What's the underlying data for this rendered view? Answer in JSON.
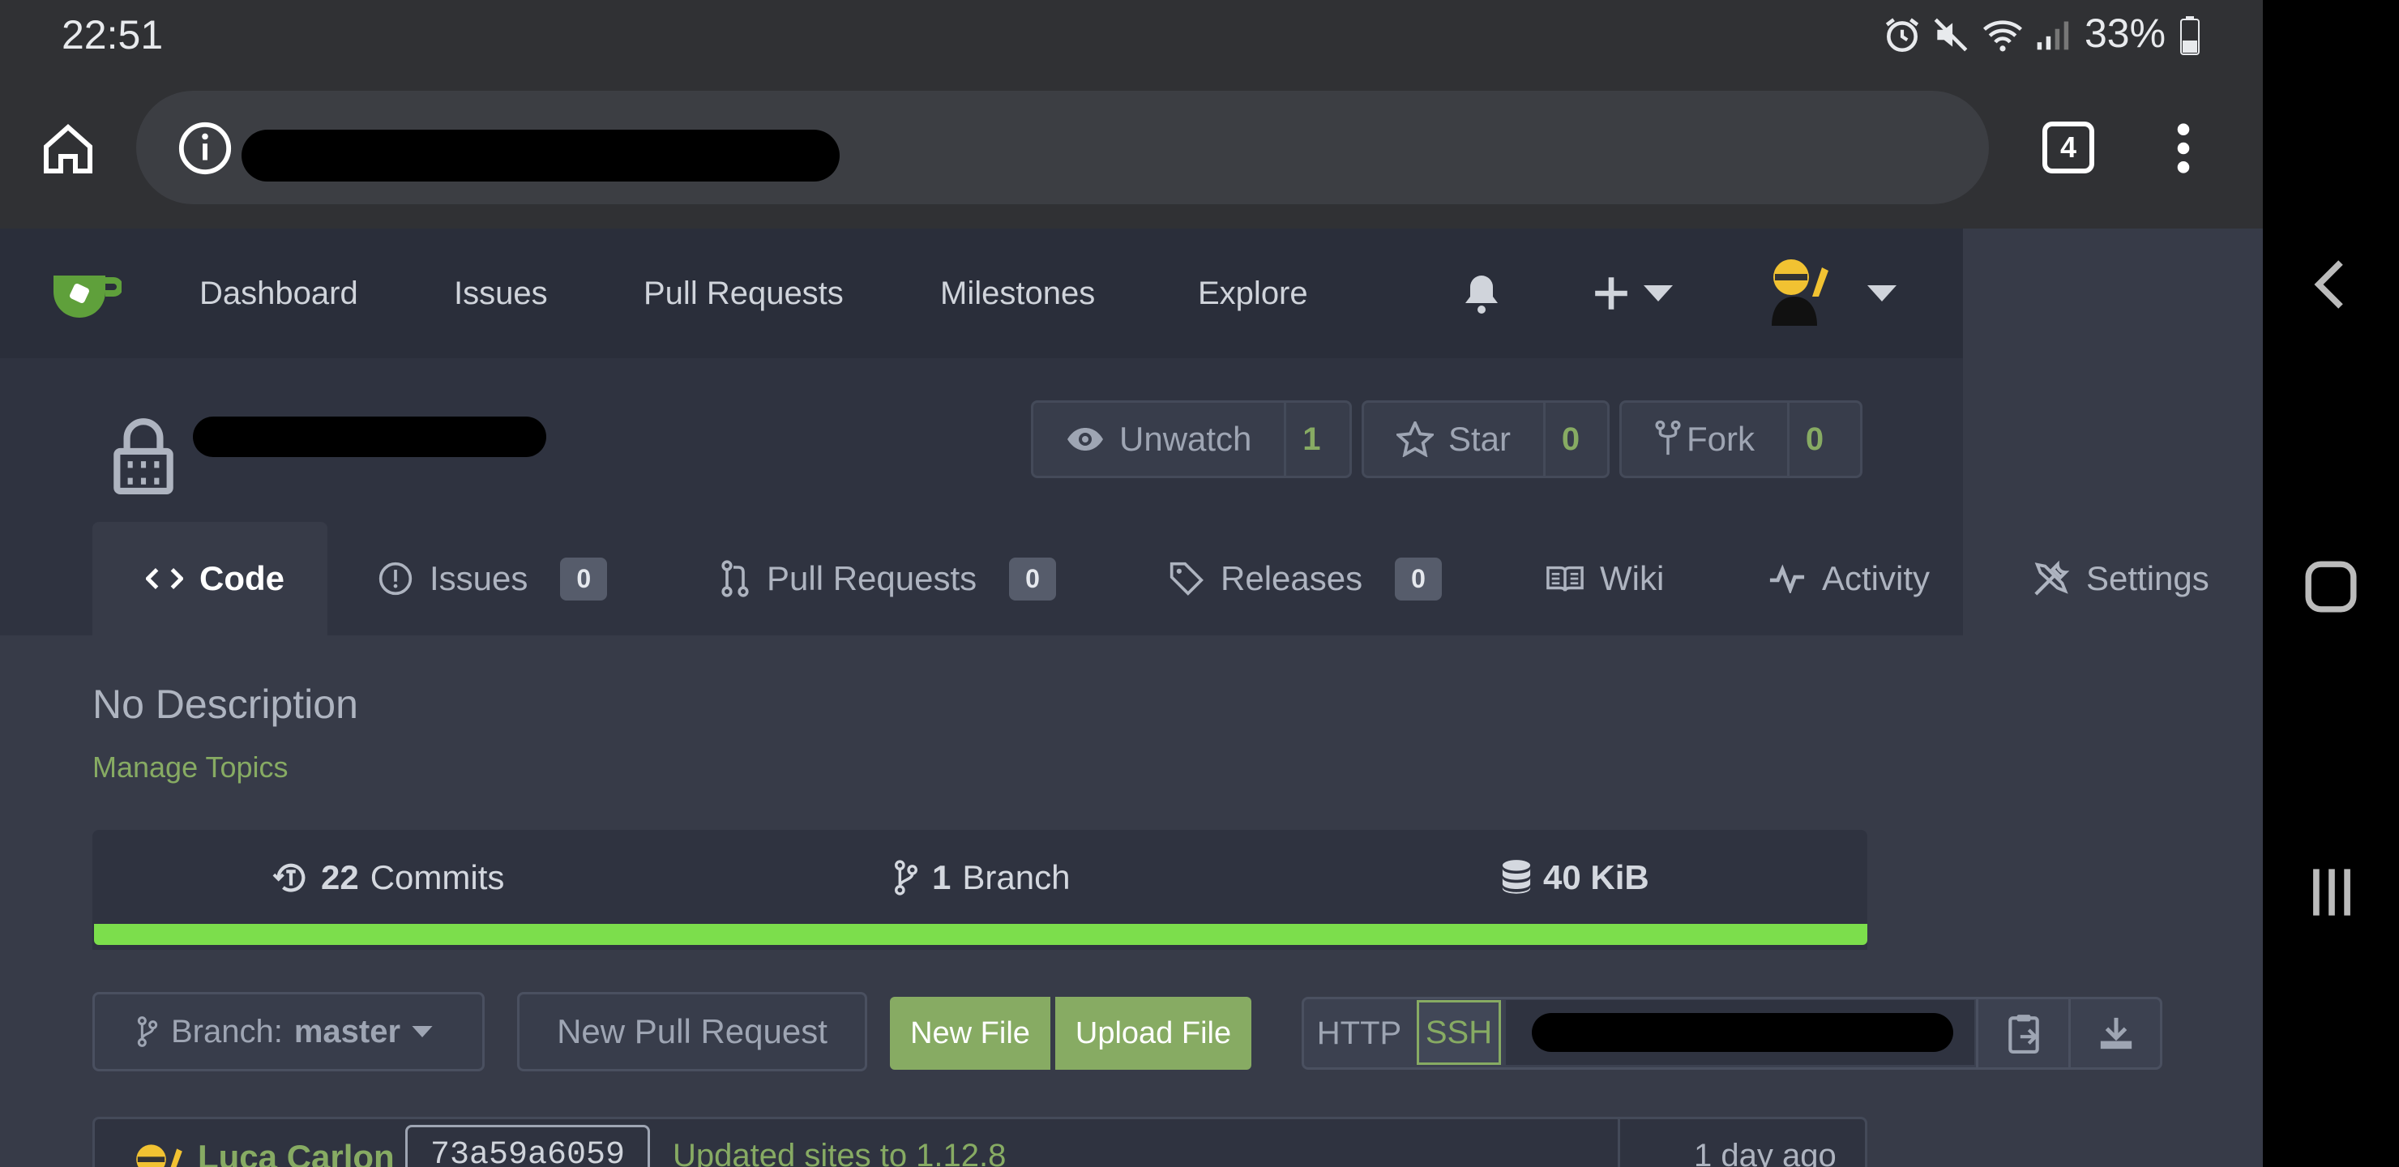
{
  "status": {
    "time": "22:51",
    "battery": "33%"
  },
  "browser": {
    "tab_count": "4"
  },
  "nav": {
    "items": [
      "Dashboard",
      "Issues",
      "Pull Requests",
      "Milestones",
      "Explore"
    ]
  },
  "repo": {
    "buttons": {
      "watch": {
        "label": "Unwatch",
        "count": "1"
      },
      "star": {
        "label": "Star",
        "count": "0"
      },
      "fork": {
        "label": "Fork",
        "count": "0"
      }
    },
    "tabs": {
      "code": "Code",
      "issues": {
        "label": "Issues",
        "count": "0"
      },
      "pulls": {
        "label": "Pull Requests",
        "count": "0"
      },
      "releases": {
        "label": "Releases",
        "count": "0"
      },
      "wiki": "Wiki",
      "activity": "Activity",
      "settings": "Settings"
    },
    "description": "No Description",
    "manage_topics": "Manage Topics",
    "stats": {
      "commits_count": "22",
      "commits_label": "Commits",
      "branch_count": "1",
      "branch_label": "Branch",
      "size": "40 KiB"
    },
    "toolbar": {
      "branch_prefix": "Branch:",
      "branch_name": "master",
      "new_pr": "New Pull Request",
      "new_file": "New File",
      "upload_file": "Upload File",
      "http": "HTTP",
      "ssh": "SSH"
    },
    "latest_commit": {
      "author": "Luca Carlon",
      "sha": "73a59a6059",
      "message": "Updated sites to 1.12.8",
      "time": "1 day ago"
    }
  },
  "colors": {
    "accent_green": "#87ab63",
    "progress_green": "#7cde4c",
    "nav_bg": "#2a2e3a",
    "page_bg": "#373b48"
  }
}
